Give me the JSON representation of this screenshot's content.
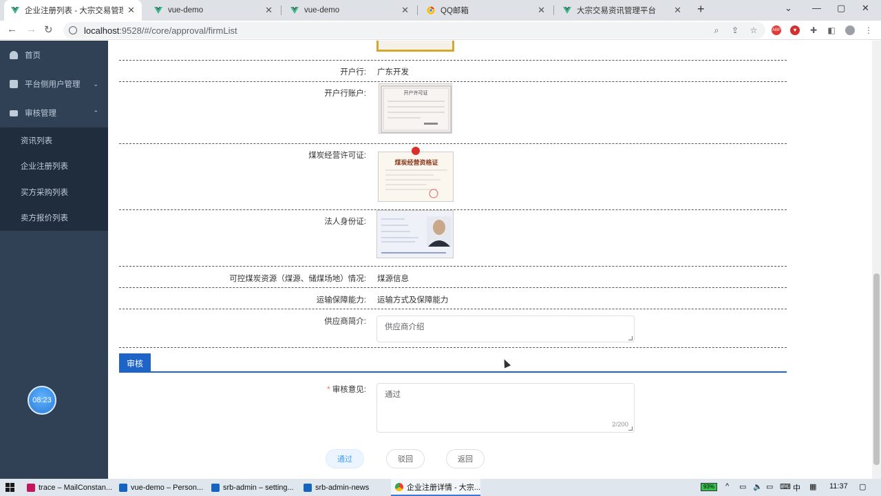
{
  "browser": {
    "tabs": [
      {
        "title": "企业注册列表 - 大宗交易管理平台",
        "active": true,
        "icon": "vue-icon"
      },
      {
        "title": "vue-demo",
        "active": false,
        "icon": "vue-icon"
      },
      {
        "title": "vue-demo",
        "active": false,
        "icon": "vue-icon"
      },
      {
        "title": "QQ邮箱",
        "active": false,
        "icon": "chrome-icon"
      },
      {
        "title": "大宗交易资讯管理平台",
        "active": false,
        "icon": "vue-icon"
      }
    ],
    "url_host": "localhost",
    "url_path": ":9528/#/core/approval/firmList"
  },
  "sidebar": {
    "items": [
      {
        "label": "首页",
        "icon": "dashboard-icon"
      },
      {
        "label": "平台侧用户管理",
        "icon": "chart-icon",
        "arrow": "⌄"
      },
      {
        "label": "审核管理",
        "icon": "list-icon",
        "arrow": "⌃"
      }
    ],
    "sub_items": [
      {
        "label": "资讯列表"
      },
      {
        "label": "企业注册列表"
      },
      {
        "label": "买方采购列表"
      },
      {
        "label": "卖方报价列表"
      }
    ],
    "clock": "08:23"
  },
  "form": {
    "bank_label": "开户行:",
    "bank_value": "广东开发",
    "account_label": "开户行账户:",
    "license_label": "煤炭经营许可证:",
    "license_img_title": "煤炭经营资格证",
    "account_img_title": "开户许可证",
    "id_label": "法人身份证:",
    "resource_label": "可控煤炭资源（煤源、储煤场地）情况:",
    "resource_value": "煤源信息",
    "transport_label": "运输保障能力:",
    "transport_value": "运输方式及保障能力",
    "supplier_label": "供应商简介:",
    "supplier_value": "供应商介绍"
  },
  "review": {
    "section_title": "审核",
    "opinion_label": "* 审核意见:",
    "opinion_value": "通过",
    "counter": "2/200",
    "buttons": {
      "approve": "通过",
      "reject": "驳回",
      "back": "返回"
    }
  },
  "taskbar": {
    "tasks": [
      {
        "label": "trace – MailConstan...",
        "color": "#c2185b"
      },
      {
        "label": "vue-demo – Person...",
        "color": "#1565c0"
      },
      {
        "label": "srb-admin – setting...",
        "color": "#1565c0"
      },
      {
        "label": "srb-admin-news",
        "color": "#1565c0"
      },
      {
        "label": "企业注册详情 - 大宗...",
        "color": "#e53935"
      }
    ],
    "battery": "93%",
    "ime": "中",
    "time": "11:37"
  }
}
